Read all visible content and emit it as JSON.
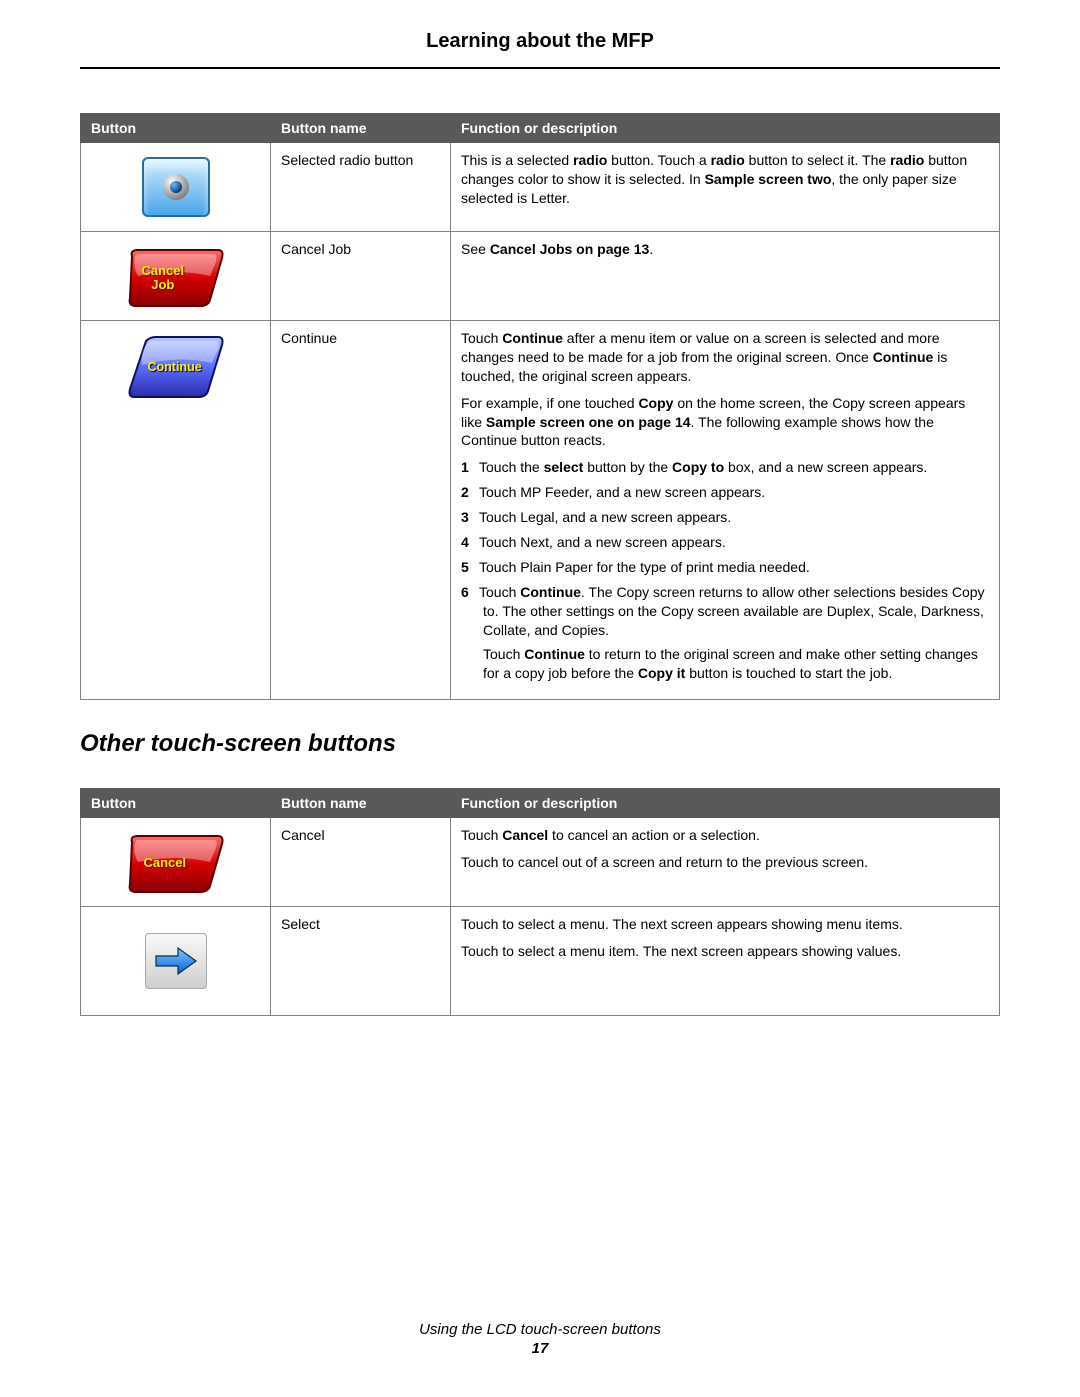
{
  "header": "Learning about the MFP",
  "table1": {
    "headers": [
      "Button",
      "Button name",
      "Function or description"
    ],
    "rows": [
      {
        "name": "Selected radio button",
        "desc_html": "This is a selected <b>radio</b> button. Touch a <b>radio</b> button to select it. The <b>radio</b> button changes color to show it is selected. In <b>Sample screen two</b>, the only paper size selected is Letter."
      },
      {
        "name": "Cancel Job",
        "icon_label": "Cancel\nJob",
        "desc_html": "See <b>Cancel Jobs on page 13</b>."
      },
      {
        "name": "Continue",
        "icon_label": "Continue",
        "desc_p1": "Touch <b>Continue</b> after a menu item or value on a screen is selected and more changes need to be made for a job from the original screen. Once <b>Continue</b> is touched, the original screen appears.",
        "desc_p2": "For example, if one touched <b>Copy</b> on the home screen, the Copy screen appears like <b>Sample screen one on page 14</b>. The following example shows how the Continue button reacts.",
        "steps": [
          "Touch the <b>select</b> button by the <b>Copy to</b> box, and a new screen appears.",
          "Touch MP Feeder, and a new screen appears.",
          "Touch Legal, and a new screen appears.",
          "Touch Next, and a new screen appears.",
          "Touch Plain Paper for the type of print media needed.",
          "Touch <b>Continue</b>. The Copy screen returns to allow other selections besides Copy to. The other settings on the Copy screen available are Duplex, Scale, Darkness, Collate, and Copies."
        ],
        "desc_p3": "Touch <b>Continue</b> to return to the original screen and make other setting changes for a copy job before the <b>Copy it</b> button is touched to start the job."
      }
    ]
  },
  "subheading": "Other touch-screen buttons",
  "table2": {
    "headers": [
      "Button",
      "Button name",
      "Function or description"
    ],
    "rows": [
      {
        "name": "Cancel",
        "icon_label": "Cancel",
        "desc_p1": "Touch <b>Cancel</b> to cancel an action or a selection.",
        "desc_p2": "Touch to cancel out of a screen and return to the previous screen."
      },
      {
        "name": "Select",
        "desc_p1": "Touch to select a menu. The next screen appears showing menu items.",
        "desc_p2": "Touch to select a menu item. The next screen appears showing values."
      }
    ]
  },
  "footer": {
    "caption": "Using the LCD touch-screen buttons",
    "page": "17"
  }
}
